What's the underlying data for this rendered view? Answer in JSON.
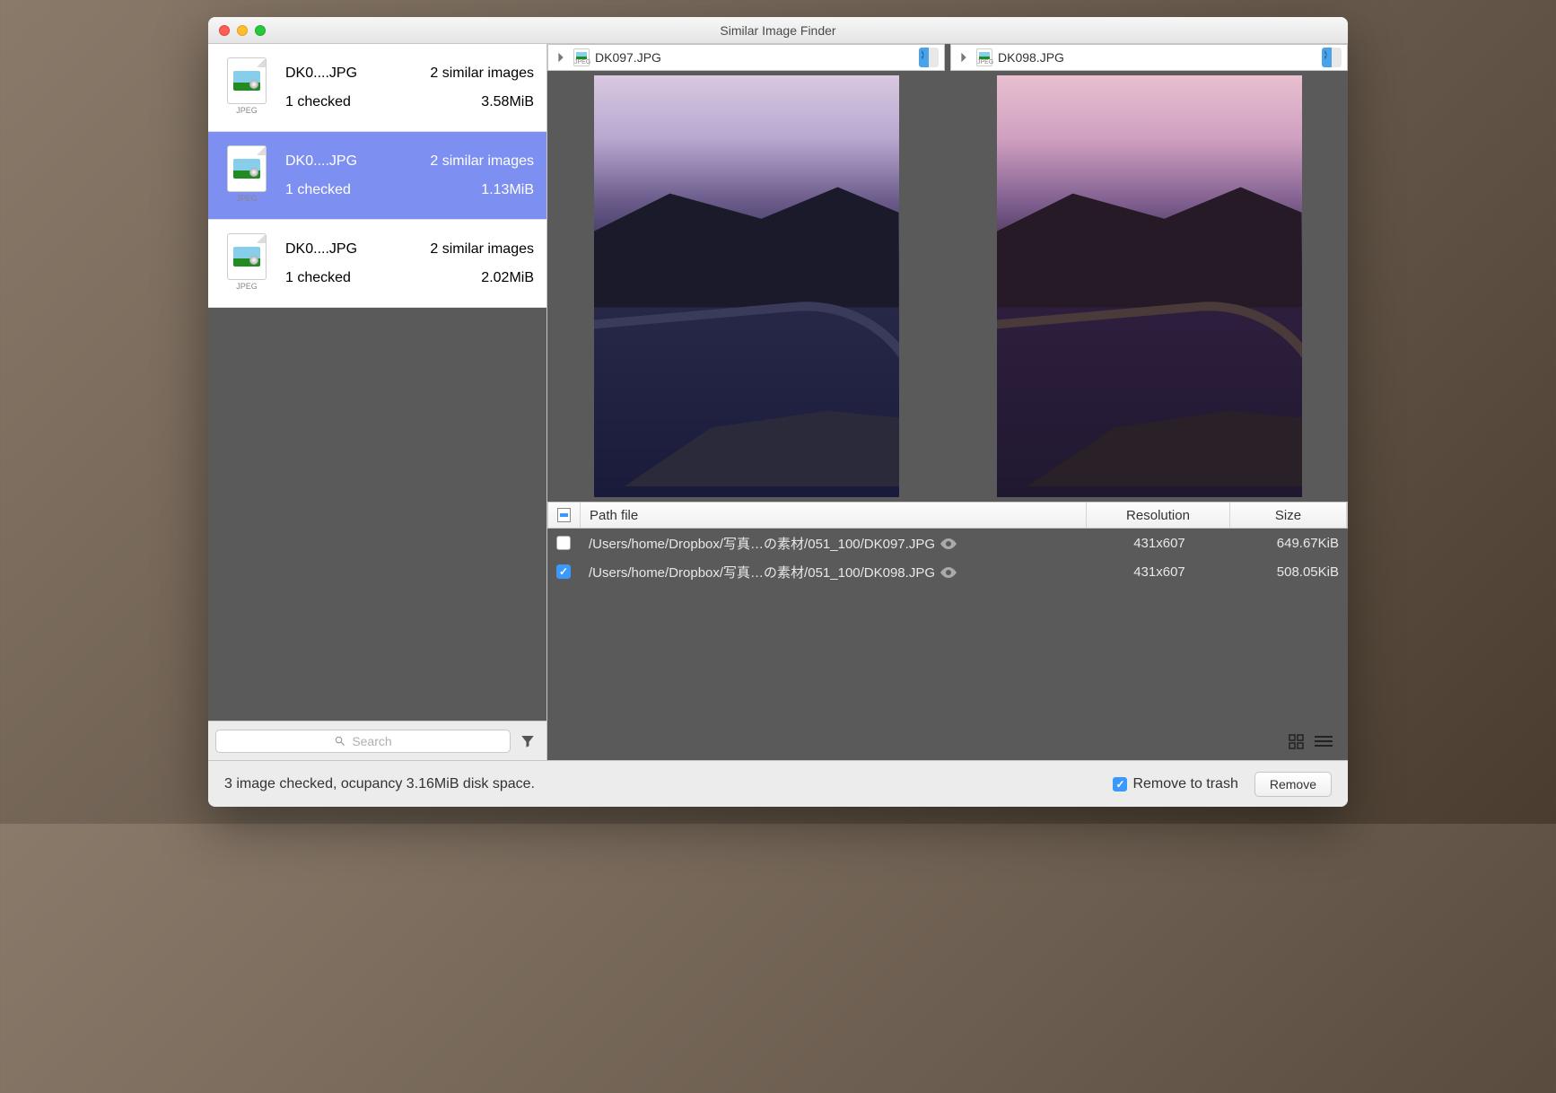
{
  "window": {
    "title": "Similar Image Finder"
  },
  "sidebar": {
    "items": [
      {
        "filename": "DK0....JPG",
        "similar": "2 similar images",
        "checked": "1 checked",
        "size": "3.58MiB",
        "type": "JPEG",
        "selected": false
      },
      {
        "filename": "DK0....JPG",
        "similar": "2 similar images",
        "checked": "1 checked",
        "size": "1.13MiB",
        "type": "JPEG",
        "selected": true
      },
      {
        "filename": "DK0....JPG",
        "similar": "2 similar images",
        "checked": "1 checked",
        "size": "2.02MiB",
        "type": "JPEG",
        "selected": false
      }
    ],
    "search_placeholder": "Search"
  },
  "previews": [
    {
      "filename": "DK097.JPG"
    },
    {
      "filename": "DK098.JPG"
    }
  ],
  "table": {
    "headers": {
      "path": "Path file",
      "resolution": "Resolution",
      "size": "Size"
    },
    "rows": [
      {
        "checked": false,
        "path": "/Users/home/Dropbox/写真…の素材/051_100/DK097.JPG",
        "resolution": "431x607",
        "size": "649.67KiB"
      },
      {
        "checked": true,
        "path": "/Users/home/Dropbox/写真…の素材/051_100/DK098.JPG",
        "resolution": "431x607",
        "size": "508.05KiB"
      }
    ]
  },
  "footer": {
    "status": "3 image checked, ocupancy 3.16MiB disk space.",
    "remove_to_trash_label": "Remove to trash",
    "remove_button": "Remove"
  }
}
